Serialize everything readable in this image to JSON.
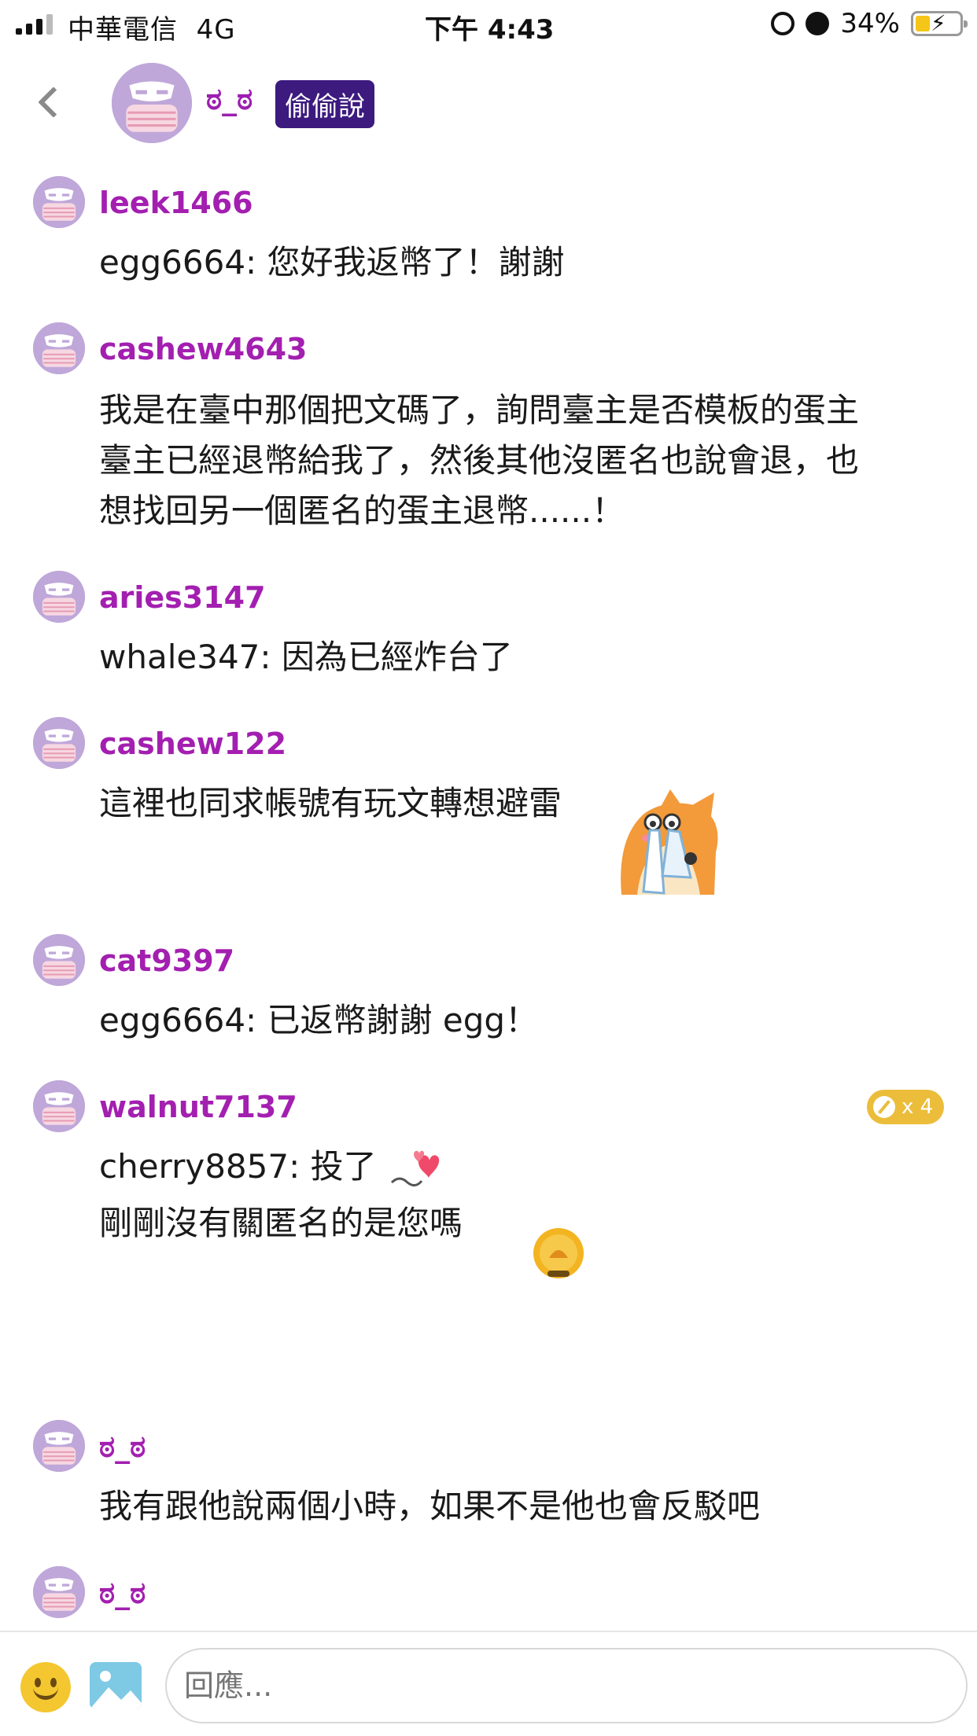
{
  "status_bar": {
    "carrier": "中華電信",
    "network": "4G",
    "time": "下午 4:43",
    "battery": "34%",
    "battery_level": 0.34
  },
  "header": {
    "name": "ಠ_ಠ",
    "badge": "偷偷說"
  },
  "messages": [
    {
      "user": "leek1466",
      "lines": [
        "egg6664: 您好我返幣了！謝謝"
      ]
    },
    {
      "user": "cashew4643",
      "lines": [
        "我是在臺中那個把文碼了，詢問臺主是否模板的蛋主",
        "臺主已經退幣給我了，然後其他沒匿名也說會退，也",
        "想找回另一個匿名的蛋主退幣......！"
      ]
    },
    {
      "user": "aries3147",
      "lines": [
        "whale347: 因為已經炸台了"
      ]
    },
    {
      "user": "cashew122",
      "lines": [
        "這裡也同求帳號有玩文轉想避雷"
      ],
      "sticker": "fox-crying-sticker"
    },
    {
      "user": "cat9397",
      "lines": [
        "egg6664: 已返幣謝謝 egg！"
      ]
    },
    {
      "user": "walnut7137",
      "lines": [
        "cherry8857: 投了",
        "剛剛沒有關匿名的是您嗎"
      ],
      "gift": "x 4",
      "stickers": [
        "hearts-sticker",
        "coin-sticker"
      ]
    },
    {
      "user": "ಠ_ಠ",
      "lines": [
        "我有跟他說兩個小時，如果不是他也會反駁吧"
      ]
    },
    {
      "user": "ಠ_ಠ",
      "lines": []
    }
  ],
  "composer": {
    "placeholder": "回應..."
  },
  "colors": {
    "username": "#a31fb0",
    "badge_bg": "#3c1a7e",
    "gift_badge": "#ebbd3a",
    "avatar_bg": "#bfa7d9"
  }
}
